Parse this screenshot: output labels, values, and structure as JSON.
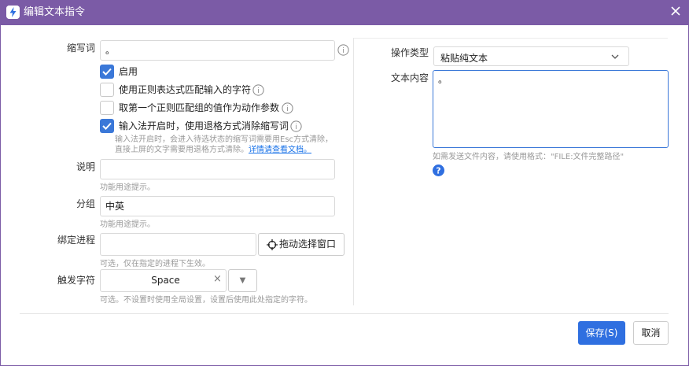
{
  "window": {
    "title": "编辑文本指令",
    "icons": {
      "app": "lightning-bolt-icon",
      "close": "close-icon"
    }
  },
  "form": {
    "abbr": {
      "label": "缩写词",
      "value": "。"
    },
    "enable": {
      "label": "启用",
      "checked": true
    },
    "regex": {
      "label": "使用正则表达式匹配输入的字符",
      "checked": false
    },
    "first_group": {
      "label": "取第一个正则匹配组的值作为动作参数",
      "checked": false
    },
    "backspace": {
      "label": "输入法开启时，使用退格方式消除缩写词",
      "checked": true,
      "hint_line1": "输入法开启时，会进入待选状态的缩写词需要用Esc方式清除，",
      "hint_line2": "直接上屏的文字需要用退格方式清除。",
      "link": "详情请查看文档。"
    },
    "description": {
      "label": "说明",
      "value": "",
      "hint": "功能用途提示。"
    },
    "group": {
      "label": "分组",
      "value": "中英",
      "hint": "功能用途提示。"
    },
    "process": {
      "label": "绑定进程",
      "value": "",
      "button": "拖动选择窗口",
      "hint": "可选，仅在指定的进程下生效。"
    },
    "trigger": {
      "label": "触发字符",
      "value": "Space",
      "clear": "×",
      "dropdown": "▼",
      "hint": "可选。不设置时使用全局设置，设置后使用此处指定的字符。"
    },
    "action_type": {
      "label": "操作类型",
      "value": "粘贴纯文本"
    },
    "content": {
      "label": "文本内容",
      "value": "。",
      "hint": "如需发送文件内容，请使用格式：\"FILE:文件完整路径\""
    }
  },
  "footer": {
    "save": "保存(S)",
    "cancel": "取消"
  },
  "colors": {
    "titlebar": "#7b5ba6",
    "accent": "#2f6fe0"
  }
}
